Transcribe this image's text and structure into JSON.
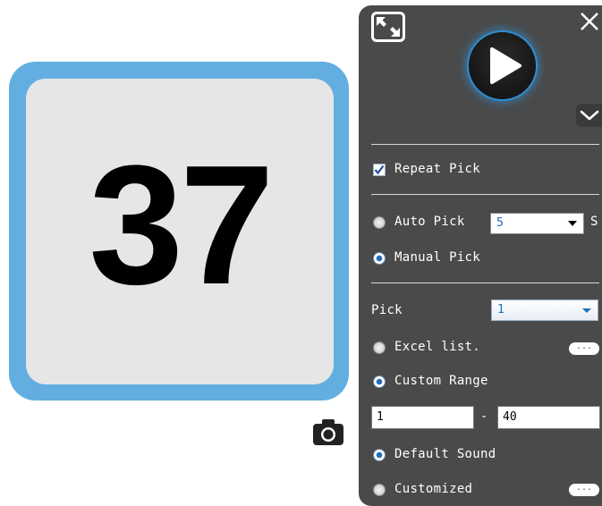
{
  "display": {
    "number": "37"
  },
  "camera": {
    "icon": "camera-icon"
  },
  "panel": {
    "close_glyph": "✕",
    "repeat_pick": {
      "label": "Repeat Pick",
      "checked": true
    },
    "auto_pick": {
      "label": "Auto Pick",
      "selected": false,
      "interval": "5",
      "unit": "S"
    },
    "manual_pick": {
      "label": "Manual Pick",
      "selected": true
    },
    "pick": {
      "label": "Pick",
      "value": "1"
    },
    "excel_list": {
      "label": "Excel list.",
      "selected": false,
      "button_label": "..."
    },
    "custom_range": {
      "label": "Custom Range",
      "selected": true,
      "from": "1",
      "dash": "-",
      "to": "40"
    },
    "default_sound": {
      "label": "Default Sound",
      "selected": true
    },
    "customized": {
      "label": "Customized",
      "selected": false,
      "button_label": "..."
    }
  },
  "colors": {
    "card_border": "#63aee0",
    "card_face": "#e6e6e6",
    "panel_bg": "#4a4a4a",
    "accent": "#1f6fb8"
  }
}
